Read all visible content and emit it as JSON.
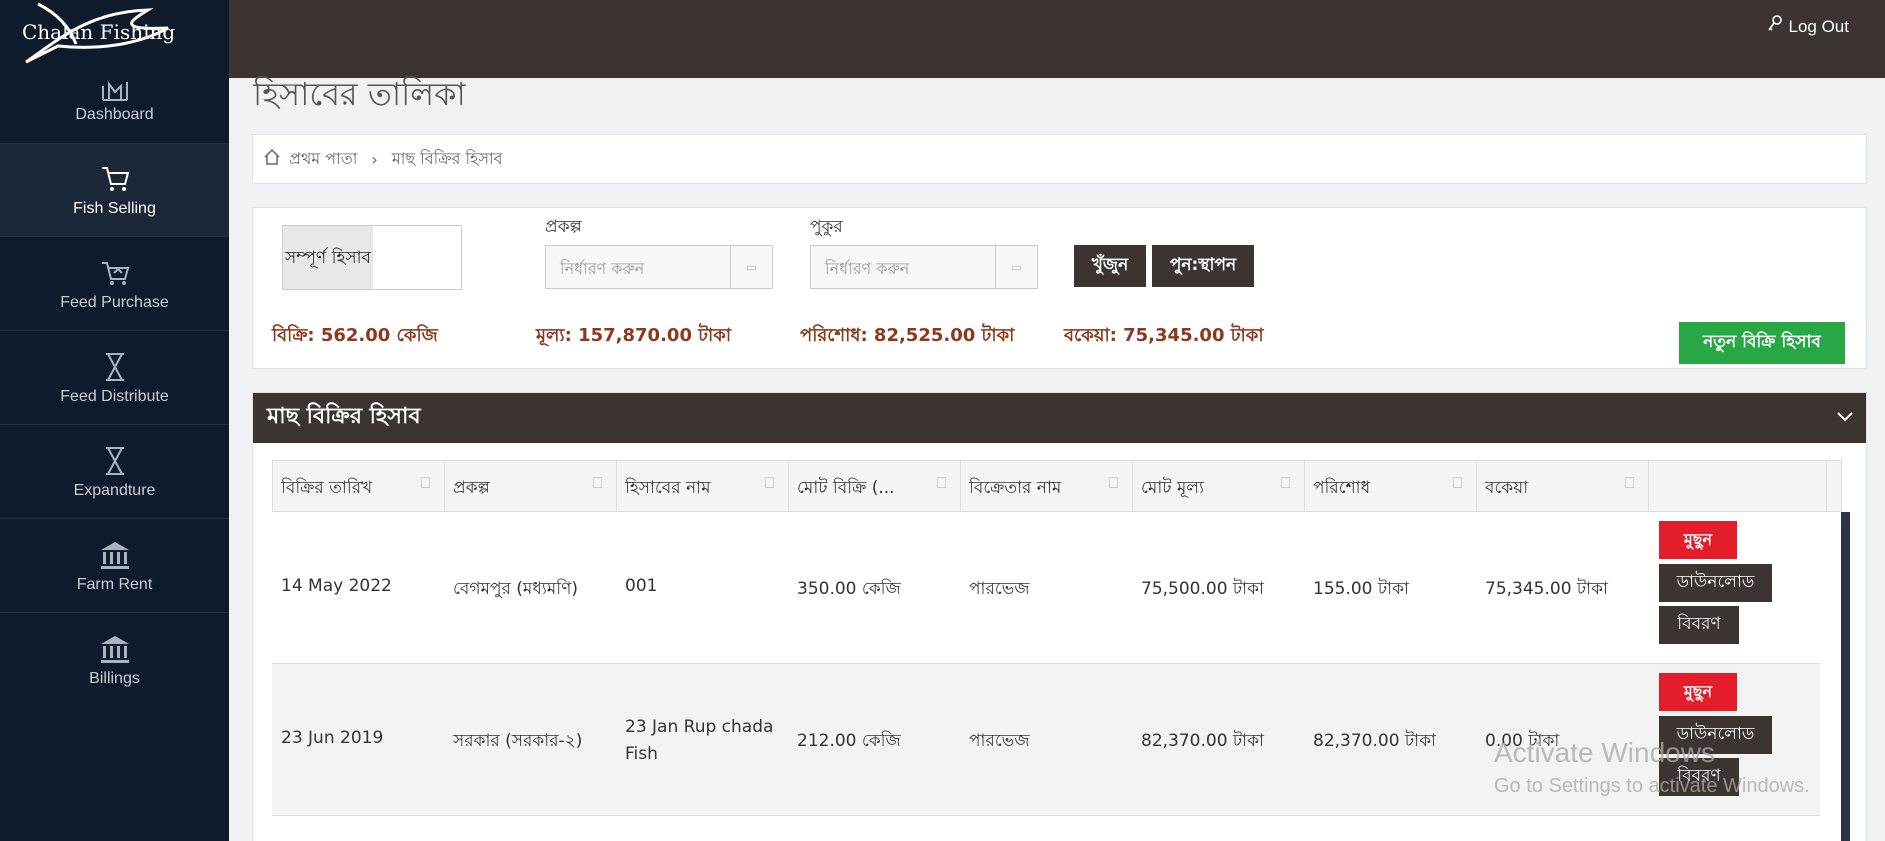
{
  "brand": {
    "name": "Chalan Fishing"
  },
  "sidebar": {
    "items": [
      {
        "label": "Dashboard",
        "icon": "chart-icon",
        "active": false
      },
      {
        "label": "Fish Selling",
        "icon": "cart-icon",
        "active": true
      },
      {
        "label": "Feed Purchase",
        "icon": "basket-icon",
        "active": false
      },
      {
        "label": "Feed Distribute",
        "icon": "hourglass-icon",
        "active": false
      },
      {
        "label": "Expandture",
        "icon": "hourglass-icon",
        "active": false
      },
      {
        "label": "Farm Rent",
        "icon": "bank-icon",
        "active": false
      },
      {
        "label": "Billings",
        "icon": "bank-icon",
        "active": false
      }
    ]
  },
  "header": {
    "logout_label": "Log Out"
  },
  "page": {
    "title": "হিসাবের তালিকা"
  },
  "breadcrumb": {
    "home": "প্রথম পাতা",
    "separator": "›",
    "current": "মাছ বিক্রির হিসাব"
  },
  "filter": {
    "toggle_label": "সম্পূর্ণ হিসাব",
    "project_label": "প্রকল্প",
    "project_placeholder": "নির্ধারণ করুন",
    "pond_label": "পুকুর",
    "pond_placeholder": "নির্ধারণ করুন",
    "search_button": "খুঁজুন",
    "reset_button": "পুন:স্থাপন"
  },
  "summary": {
    "sold": "বিক্রি: 562.00 কেজি",
    "price": "মূল্য: 157,870.00 টাকা",
    "paid": "পরিশোধ: 82,525.00 টাকা",
    "due": "বকেয়া: 75,345.00 টাকা",
    "new_button": "নতুন বিক্রি হিসাব"
  },
  "table": {
    "title": "মাছ বিক্রির হিসাব",
    "columns": [
      "বিক্রির তারিখ",
      "প্রকল্প",
      "হিসাবের নাম",
      "মোট বিক্রি (...",
      "বিক্রেতার নাম",
      "মোট মূল্য",
      "পরিশোধ",
      "বকেয়া"
    ],
    "actions": {
      "delete": "মুছুন",
      "download": "ডাউনলোড",
      "details": "বিবরণ"
    },
    "rows": [
      {
        "date": "14 May 2022",
        "project": "বেগমপুর (মধ্যমণি)",
        "name": "001",
        "total": "350.00 কেজি",
        "seller": "পারভেজ",
        "price": "75,500.00 টাকা",
        "paid": "155.00 টাকা",
        "due": "75,345.00 টাকা"
      },
      {
        "date": "23 Jun 2019",
        "project": "সরকার (সরকার-২)",
        "name": "23 Jan Rup chada Fish",
        "total": "212.00 কেজি",
        "seller": "পারভেজ",
        "price": "82,370.00 টাকা",
        "paid": "82,370.00 টাকা",
        "due": "0.00 টাকা"
      }
    ]
  },
  "watermark": {
    "line1": "Activate Windows",
    "line2": "Go to Settings to activate Windows."
  },
  "colors": {
    "sidebar": "#0f1b2a",
    "topbar": "#3b3431",
    "accent_red": "#e31e2a",
    "accent_green": "#28a745",
    "summary_text": "#8b3a1e"
  }
}
